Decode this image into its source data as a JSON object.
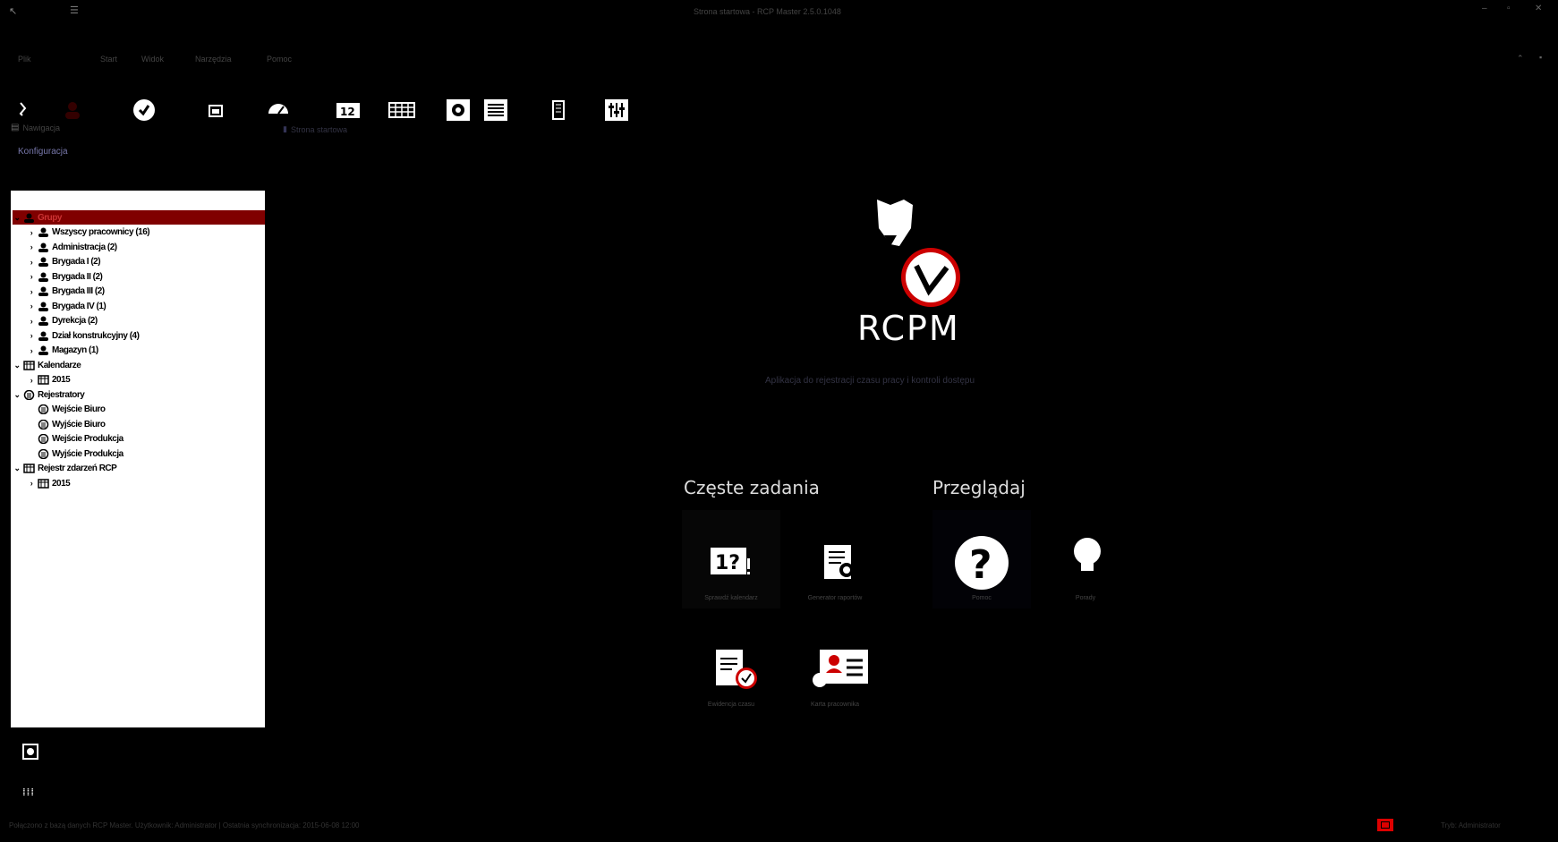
{
  "window": {
    "title": "Strona startowa - RCP Master 2.5.0.1048",
    "controls": [
      "minimize",
      "maximize",
      "close"
    ]
  },
  "menu": [
    "Plik",
    "Start",
    "Widok",
    "Narzędzia",
    "Pomoc"
  ],
  "toolbar": {
    "icons": [
      "login-icon",
      "user-icon",
      "clock-check-icon",
      "calendar-icon",
      "dashboard-icon",
      "calendar-12-icon",
      "grid-icon",
      "settings-icon",
      "list-icon",
      "building-icon",
      "sliders-icon"
    ]
  },
  "left_panel": {
    "header": "Nawigacja",
    "config_link": "Konfiguracja",
    "tree": [
      {
        "label": "Grupy",
        "level": 0,
        "expanded": true,
        "icon": "group-icon",
        "selected": true
      },
      {
        "label": "Wszyscy pracownicy (16)",
        "level": 1,
        "icon": "person-icon"
      },
      {
        "label": "Administracja (2)",
        "level": 1,
        "icon": "person-icon"
      },
      {
        "label": "Brygada I (2)",
        "level": 1,
        "icon": "person-icon"
      },
      {
        "label": "Brygada II (2)",
        "level": 1,
        "icon": "person-icon"
      },
      {
        "label": "Brygada III (2)",
        "level": 1,
        "icon": "person-icon"
      },
      {
        "label": "Brygada IV (1)",
        "level": 1,
        "icon": "person-icon"
      },
      {
        "label": "Dyrekcja (2)",
        "level": 1,
        "icon": "person-icon"
      },
      {
        "label": "Dział konstrukcyjny (4)",
        "level": 1,
        "icon": "person-icon"
      },
      {
        "label": "Magazyn (1)",
        "level": 1,
        "icon": "person-icon"
      },
      {
        "label": "Kalendarze",
        "level": 0,
        "expanded": true,
        "icon": "calendar-icon"
      },
      {
        "label": "2015",
        "level": 1,
        "icon": "calendar-icon"
      },
      {
        "label": "Rejestratory",
        "level": 0,
        "expanded": true,
        "icon": "recorder-icon"
      },
      {
        "label": "Wejście Biuro",
        "level": 1,
        "icon": "recorder-icon",
        "leaf": true
      },
      {
        "label": "Wyjście Biuro",
        "level": 1,
        "icon": "recorder-icon",
        "leaf": true
      },
      {
        "label": "Wejście Produkcja",
        "level": 1,
        "icon": "recorder-icon",
        "leaf": true
      },
      {
        "label": "Wyjście Produkcja",
        "level": 1,
        "icon": "recorder-icon",
        "leaf": true
      },
      {
        "label": "Rejestr zdarzeń RCP",
        "level": 0,
        "expanded": true,
        "icon": "register-icon"
      },
      {
        "label": "2015",
        "level": 1,
        "icon": "register-icon"
      }
    ]
  },
  "main": {
    "tab_label": "Strona startowa",
    "logo_text": "RCPM",
    "tagline": "Aplikacja do rejestracji czasu pracy i kontroli dostępu",
    "common_tasks_title": "Częste zadania",
    "browse_title": "Przeglądaj",
    "common_tasks": [
      {
        "icon": "calendar-question-icon",
        "label": "Sprawdź kalendarz"
      },
      {
        "icon": "report-settings-icon",
        "label": "Generator raportów"
      },
      {
        "icon": "clipboard-clock-icon",
        "label": "Ewidencja czasu"
      },
      {
        "icon": "id-card-icon",
        "label": "Karta pracownika"
      }
    ],
    "browse": [
      {
        "icon": "help-icon",
        "label": "Pomoc"
      },
      {
        "icon": "lightbulb-icon",
        "label": "Porady"
      }
    ]
  },
  "statusbar": {
    "text": "Połączono z bazą danych RCP Master. Użytkownik: Administrator | Ostatnia synchronizacja: 2015-06-08 12:00",
    "right_text": "Tryb: Administrator"
  },
  "colors": {
    "accent": "#cc0000",
    "selected_row": "#800000",
    "background": "#000000"
  }
}
